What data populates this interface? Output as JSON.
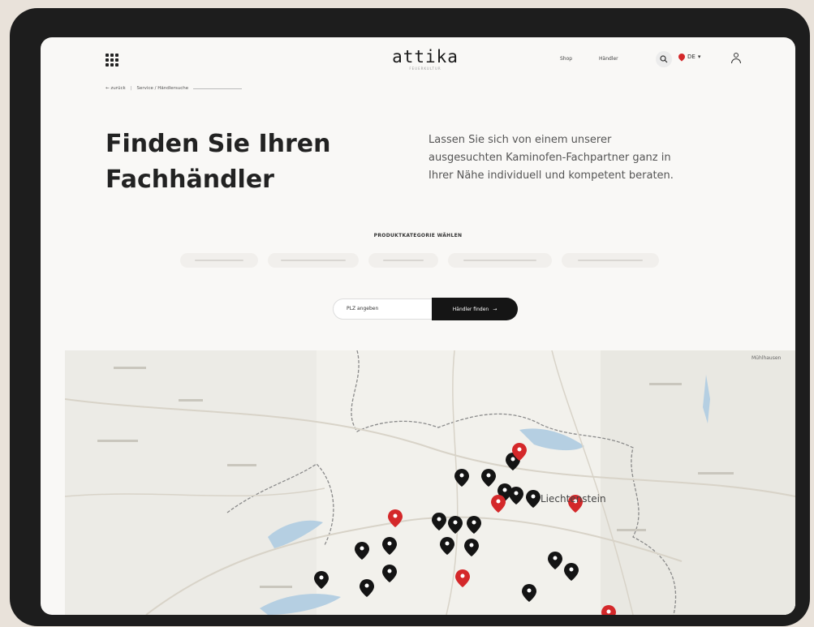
{
  "header": {
    "logo": "attika",
    "logo_tagline": "FEUERKULTUR",
    "nav": [
      "Shop",
      "Händler"
    ],
    "lang": "DE"
  },
  "breadcrumb": [
    "← zurück",
    "Service / Händlersuche"
  ],
  "hero": {
    "title": "Finden Sie Ihren\nFachhändler",
    "text": "Lassen Sie sich von einem unserer\nausgesuchten Kaminofen-Fachpartner ganz in\nIhrer Nähe individuell und kompetent beraten."
  },
  "categories": {
    "label": "PRODUKTKATEGORIE WÄHLEN"
  },
  "search": {
    "placeholder": "PLZ angeben",
    "button": "Händler finden"
  },
  "map": {
    "city_label": "Liechtenstein",
    "corner_label": "Mühlhausen",
    "pins_black": 21,
    "pins_red": 7,
    "pin_colors": {
      "black": "#141414",
      "red": "#d4282a"
    }
  },
  "colors": {
    "accent": "#d4282a",
    "button_bg": "#151515",
    "lake": "#b5cfe2"
  }
}
